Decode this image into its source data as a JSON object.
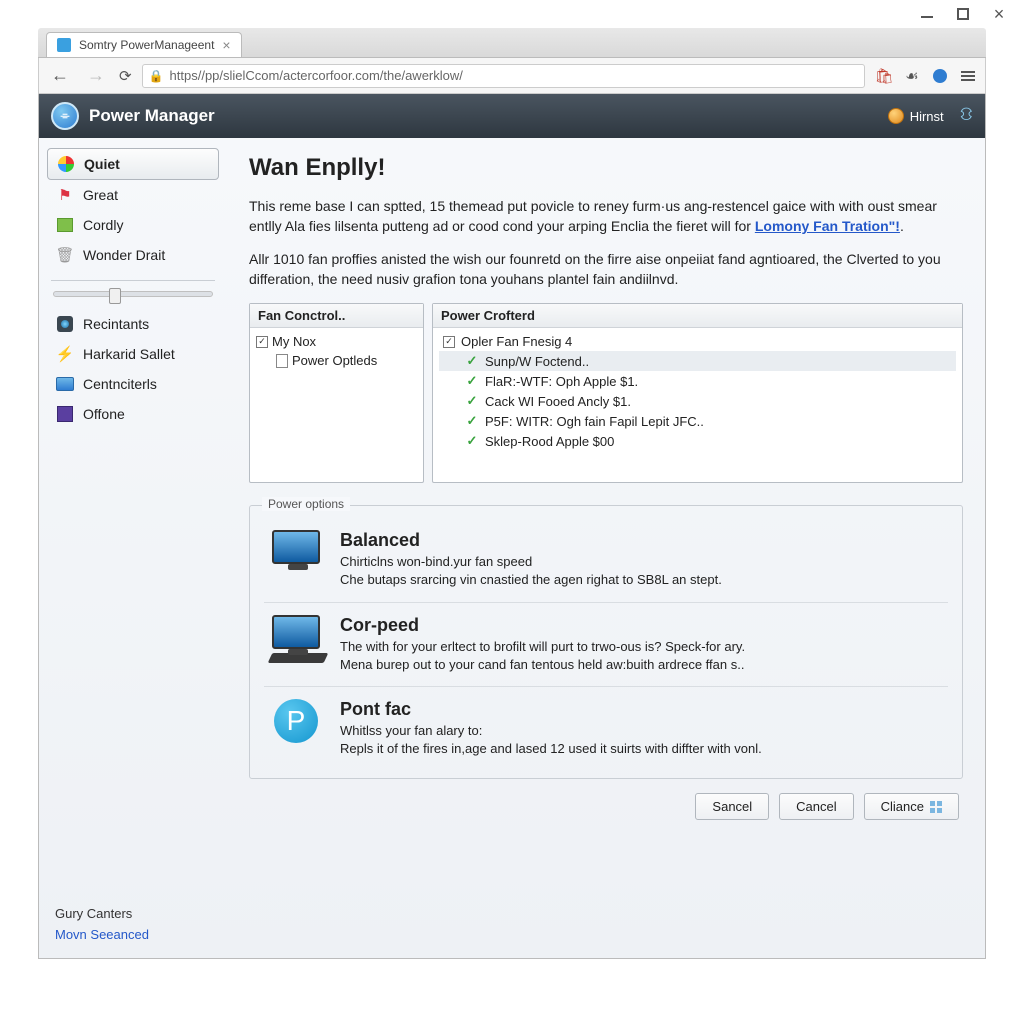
{
  "window": {
    "tab_title": "Somtry PowerManageent"
  },
  "browser": {
    "url": "https//pp/slielCcom/actercorfoor.com/the/awerklow/"
  },
  "app_header": {
    "title": "Power Manager",
    "user": "Hirnst"
  },
  "sidebar": {
    "groups": {
      "top": [
        {
          "label": "Quiet"
        },
        {
          "label": "Great"
        },
        {
          "label": "Cordly"
        },
        {
          "label": "Wonder Drait"
        }
      ],
      "bottom": [
        {
          "label": "Recintants"
        },
        {
          "label": "Harkarid Sallet"
        },
        {
          "label": "Centnciterls"
        },
        {
          "label": "Offone"
        }
      ]
    },
    "footer1": "Gury Canters",
    "footer2": "Movn Seeanced"
  },
  "content": {
    "heading": "Wan Enplly!",
    "intro_pre": "This reme base I can sptted, 15 themead put povicle to reney furm·us ang-restencel gaice with with oust smear entlly Ala fies lilsenta putteng ad or cood cond your arping Enclia the fieret will for ",
    "intro_link": "Lomony Fan Tration\"!",
    "intro_post": ".",
    "intro2": "Allr 1010 fan proffies anisted the wish our founretd on the firre aise onpeiiat fand agntioared, the Clverted to you differation, the need nusiv grafion tona youhans plantel fain andiilnvd.",
    "left_pane": {
      "header": "Fan Conctrol..",
      "root": "My Nox",
      "child": "Power Optleds"
    },
    "right_pane": {
      "header": "Power Crofterd",
      "root": "Opler Fan Fnesig 4",
      "items": [
        "Sunp/W Foctend..",
        "FlaR:-WTF: Oph Apple $1.",
        "Cack WI Fooed Ancly $1.",
        "P5F: WITR: Ogh fain Fapil Lepit JFC..",
        "Sklep-Rood Apple $00"
      ]
    },
    "group_legend": "Power options",
    "options": [
      {
        "title": "Balanced",
        "line1": "Chirticlns won-bind.yur fan speed",
        "line2": "Che butaps srarcing vin cnastied the agen righat to SB8L an stept."
      },
      {
        "title": "Cor-peed",
        "line1": "The with for your erltect to brofilt will purt to trwo-ous is? Speck-for ary.",
        "line2": "Mena burep out to your cand fan tentous held aw:buith ardrece ffan s.."
      },
      {
        "title": "Pont fac",
        "line1": "Whitlss your fan alary to:",
        "line2": "Repls it of the fires in,age and lased 12 used it suirts with diffter with vonl."
      }
    ],
    "buttons": {
      "b1": "Sancel",
      "b2": "Cancel",
      "b3": "Cliance"
    }
  }
}
